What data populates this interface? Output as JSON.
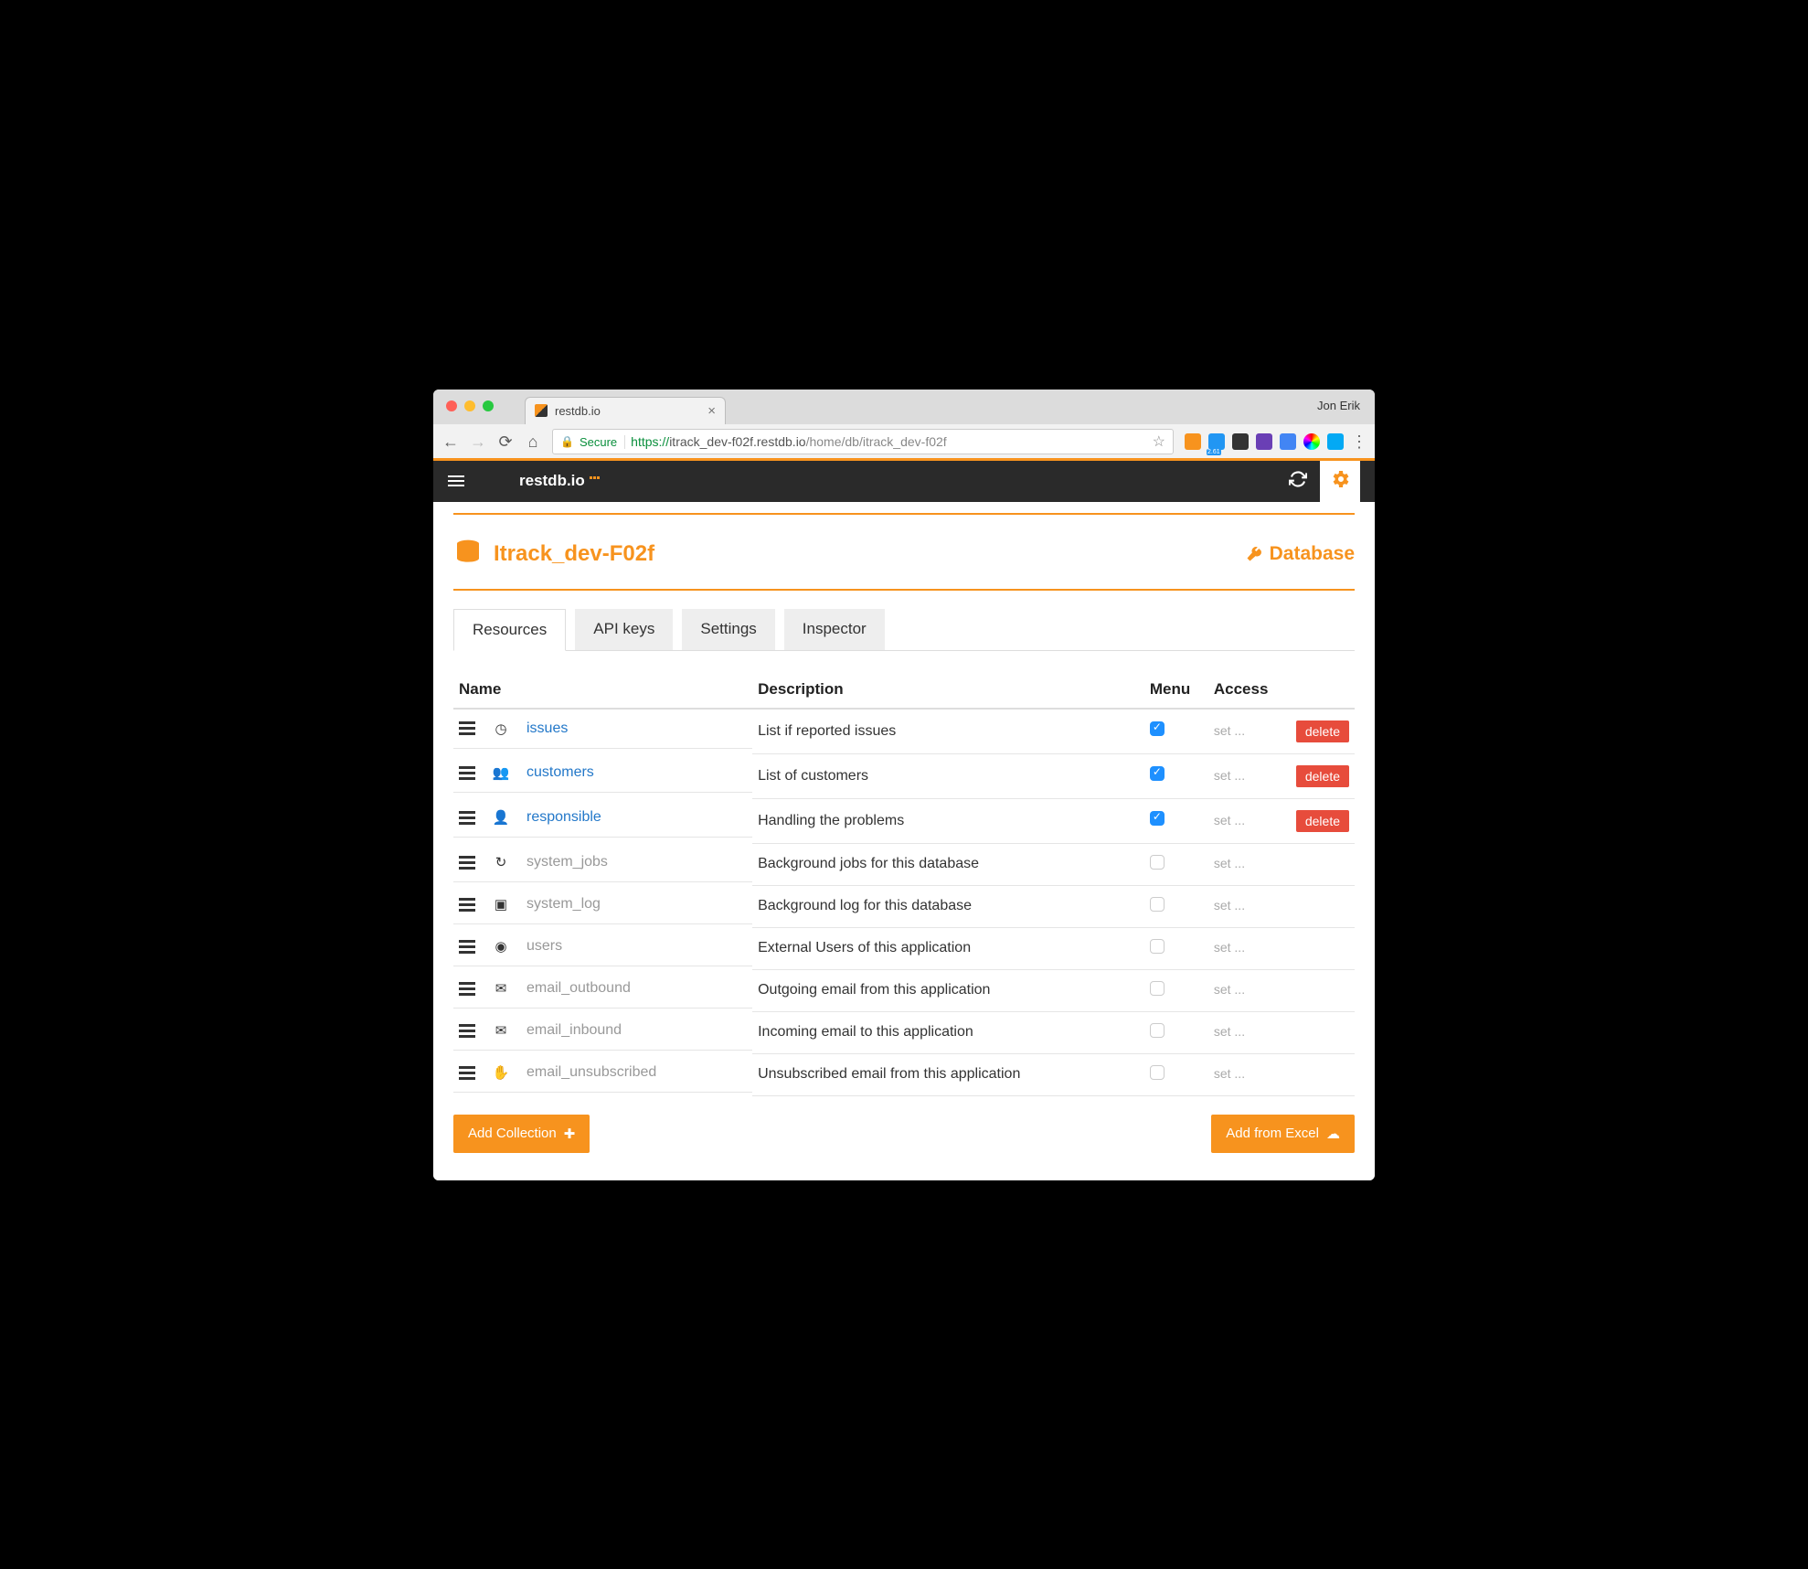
{
  "browser": {
    "tab_title": "restdb.io",
    "profile": "Jon Erik",
    "secure_label": "Secure",
    "url_scheme": "https://",
    "url_host": "itrack_dev-f02f.restdb.io",
    "url_path": "/home/db/itrack_dev-f02f",
    "ext_badge": "2.61"
  },
  "header": {
    "logo_text": "restdb.io"
  },
  "page": {
    "title": "Itrack_dev-F02f",
    "database_link": "Database"
  },
  "tabs": [
    {
      "label": "Resources",
      "active": true
    },
    {
      "label": "API keys",
      "active": false
    },
    {
      "label": "Settings",
      "active": false
    },
    {
      "label": "Inspector",
      "active": false
    }
  ],
  "table": {
    "headers": {
      "name": "Name",
      "description": "Description",
      "menu": "Menu",
      "access": "Access"
    },
    "set_label": "set ...",
    "delete_label": "delete",
    "rows": [
      {
        "icon": "clock-refresh-icon",
        "name": "issues",
        "system": false,
        "description": "List if reported issues",
        "menu": true,
        "deletable": true
      },
      {
        "icon": "users-icon",
        "name": "customers",
        "system": false,
        "description": "List of customers",
        "menu": true,
        "deletable": true
      },
      {
        "icon": "user-plus-icon",
        "name": "responsible",
        "system": false,
        "description": "Handling the problems",
        "menu": true,
        "deletable": true
      },
      {
        "icon": "refresh-icon",
        "name": "system_jobs",
        "system": true,
        "description": "Background jobs for this database",
        "menu": false,
        "deletable": false
      },
      {
        "icon": "terminal-icon",
        "name": "system_log",
        "system": true,
        "description": "Background log for this database",
        "menu": false,
        "deletable": false
      },
      {
        "icon": "user-circle-icon",
        "name": "users",
        "system": true,
        "description": "External Users of this application",
        "menu": false,
        "deletable": false
      },
      {
        "icon": "envelope-icon",
        "name": "email_outbound",
        "system": true,
        "description": "Outgoing email from this application",
        "menu": false,
        "deletable": false
      },
      {
        "icon": "envelope-icon",
        "name": "email_inbound",
        "system": true,
        "description": "Incoming email to this application",
        "menu": false,
        "deletable": false
      },
      {
        "icon": "hand-icon",
        "name": "email_unsubscribed",
        "system": true,
        "description": "Unsubscribed email from this application",
        "menu": false,
        "deletable": false
      }
    ]
  },
  "buttons": {
    "add_collection": "Add Collection",
    "add_from_excel": "Add from Excel"
  }
}
